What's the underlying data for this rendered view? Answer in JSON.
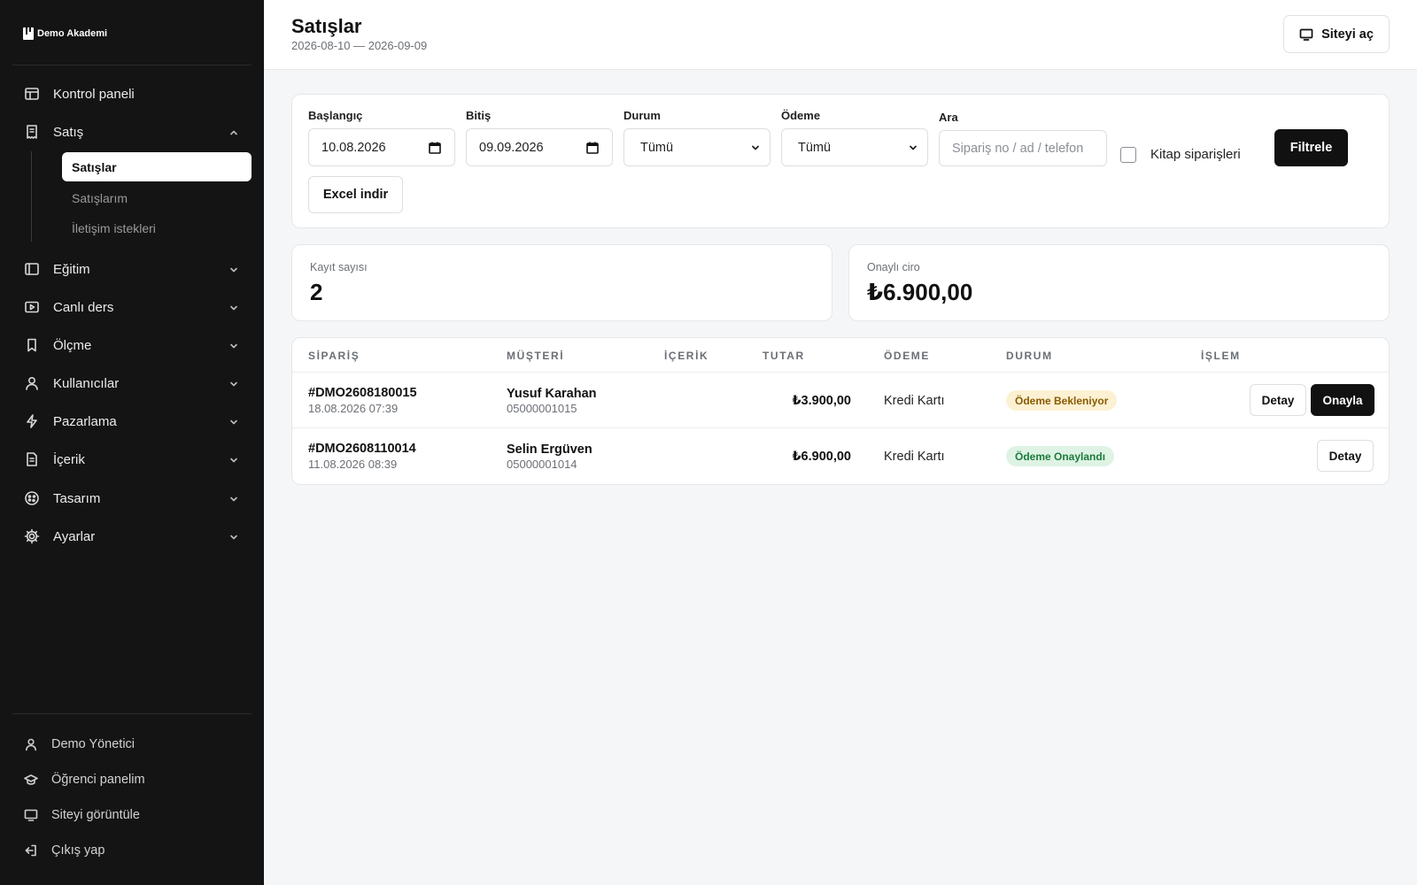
{
  "brand": {
    "name": "Demo Akademi"
  },
  "sidebar": {
    "items": [
      {
        "label": "Kontrol paneli",
        "icon": "layout-icon"
      },
      {
        "label": "Satış",
        "icon": "receipt-icon",
        "expanded": true
      },
      {
        "label": "Eğitim",
        "icon": "book-icon"
      },
      {
        "label": "Canlı ders",
        "icon": "video-icon"
      },
      {
        "label": "Ölçme",
        "icon": "bookmark-icon"
      },
      {
        "label": "Kullanıcılar",
        "icon": "user-icon"
      },
      {
        "label": "Pazarlama",
        "icon": "lightning-icon"
      },
      {
        "label": "İçerik",
        "icon": "document-icon"
      },
      {
        "label": "Tasarım",
        "icon": "palette-icon"
      },
      {
        "label": "Ayarlar",
        "icon": "gear-icon"
      }
    ],
    "sub_items": [
      {
        "label": "Satışlar",
        "active": true
      },
      {
        "label": "Satışlarım"
      },
      {
        "label": "İletişim istekleri"
      }
    ],
    "footer": [
      {
        "label": "Demo Yönetici",
        "icon": "user-icon"
      },
      {
        "label": "Öğrenci panelim",
        "icon": "graduation-cap-icon"
      },
      {
        "label": "Siteyi görüntüle",
        "icon": "monitor-icon"
      },
      {
        "label": "Çıkış yap",
        "icon": "logout-icon"
      }
    ]
  },
  "header": {
    "title": "Satışlar",
    "subtitle": "2026-08-10 — 2026-09-09",
    "site_button": "Siteyi aç"
  },
  "filters": {
    "start_label": "Başlangıç",
    "start_value": "10.08.2026",
    "end_label": "Bitiş",
    "end_value": "09.09.2026",
    "status_label": "Durum",
    "status_value": "Tümü",
    "payment_label": "Ödeme",
    "payment_value": "Tümü",
    "search_label": "Ara",
    "search_placeholder": "Sipariş no / ad / telefon",
    "books_label": "Kitap siparişleri",
    "books_checked": false,
    "filter_button": "Filtrele",
    "excel_button": "Excel indir"
  },
  "stats": {
    "count_label": "Kayıt sayısı",
    "count_value": "2",
    "revenue_label": "Onaylı ciro",
    "revenue_value": "₺6.900,00"
  },
  "table": {
    "headers": [
      "SİPARİŞ",
      "MÜŞTERİ",
      "İÇERİK",
      "TUTAR",
      "ÖDEME",
      "DURUM",
      "İŞLEM"
    ],
    "rows": [
      {
        "order_no": "#DMO2608180015",
        "date": "18.08.2026 07:39",
        "customer": "Yusuf Karahan",
        "phone": "05000001015",
        "content": "",
        "amount": "₺3.900,00",
        "payment": "Kredi Kartı",
        "status": "Ödeme Bekleniyor",
        "status_color": "#fdf1d3",
        "actions": [
          "Detay",
          "Onayla"
        ]
      },
      {
        "order_no": "#DMO2608110014",
        "date": "11.08.2026 08:39",
        "customer": "Selin Ergüven",
        "phone": "05000001014",
        "content": "",
        "amount": "₺6.900,00",
        "payment": "Kredi Kartı",
        "status": "Ödeme Onaylandı",
        "status_color": "#def3e4",
        "actions": [
          "Detay"
        ]
      }
    ]
  }
}
